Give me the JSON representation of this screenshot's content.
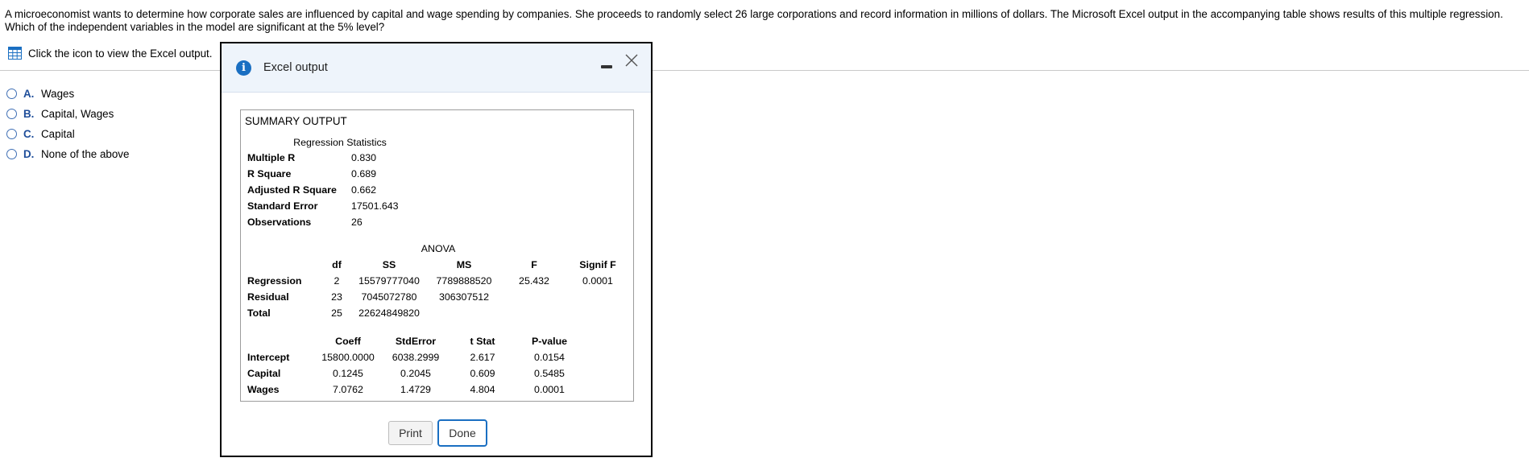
{
  "question": {
    "text": "A microeconomist wants to determine how corporate sales are influenced by capital and wage spending by companies. She proceeds to randomly select 26 large corporations and record information in millions of dollars. The Microsoft Excel output in the accompanying table shows results of this multiple regression. Which of the independent variables in the model are significant at the 5% level?",
    "excel_link": "Click the icon to view the Excel output."
  },
  "options": [
    {
      "letter": "A.",
      "label": "Wages"
    },
    {
      "letter": "B.",
      "label": "Capital, Wages"
    },
    {
      "letter": "C.",
      "label": "Capital"
    },
    {
      "letter": "D.",
      "label": "None of the above"
    }
  ],
  "dialog": {
    "title": "Excel output",
    "summary_title": "SUMMARY OUTPUT",
    "regression_statistics": {
      "heading": "Regression Statistics",
      "rows": [
        {
          "label": "Multiple R",
          "value": "0.830"
        },
        {
          "label": "R Square",
          "value": "0.689"
        },
        {
          "label": "Adjusted R Square",
          "value": "0.662"
        },
        {
          "label": "Standard Error",
          "value": "17501.643"
        },
        {
          "label": "Observations",
          "value": "26"
        }
      ]
    },
    "anova": {
      "heading": "ANOVA",
      "columns": [
        "df",
        "SS",
        "MS",
        "F",
        "Signif F"
      ],
      "rows": [
        {
          "label": "Regression",
          "df": "2",
          "ss": "15579777040",
          "ms": "7789888520",
          "f": "25.432",
          "sig": "0.0001"
        },
        {
          "label": "Residual",
          "df": "23",
          "ss": "7045072780",
          "ms": "306307512",
          "f": "",
          "sig": ""
        },
        {
          "label": "Total",
          "df": "25",
          "ss": "22624849820",
          "ms": "",
          "f": "",
          "sig": ""
        }
      ]
    },
    "coefficients": {
      "columns": [
        "Coeff",
        "StdError",
        "t Stat",
        "P-value"
      ],
      "rows": [
        {
          "label": "Intercept",
          "coeff": "15800.0000",
          "se": "6038.2999",
          "t": "2.617",
          "p": "0.0154"
        },
        {
          "label": "Capital",
          "coeff": "0.1245",
          "se": "0.2045",
          "t": "0.609",
          "p": "0.5485"
        },
        {
          "label": "Wages",
          "coeff": "7.0762",
          "se": "1.4729",
          "t": "4.804",
          "p": "0.0001"
        }
      ]
    },
    "buttons": {
      "print": "Print",
      "done": "Done"
    }
  },
  "colors": {
    "accent": "#1a6fc2",
    "option_letter": "#1f4e9a",
    "header_bg": "#eef4fb"
  }
}
